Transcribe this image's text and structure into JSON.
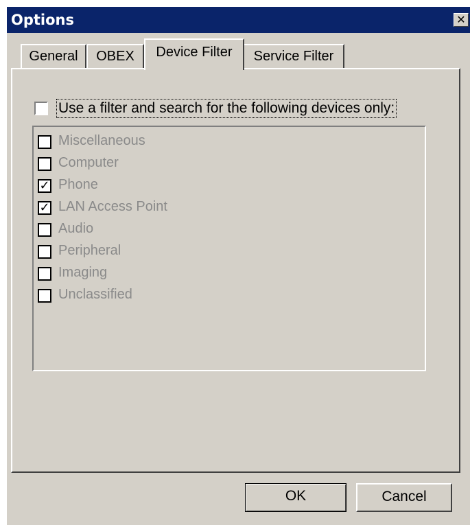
{
  "window": {
    "title": "Options",
    "close_glyph": "✕"
  },
  "tabs": [
    {
      "label": "General",
      "active": false
    },
    {
      "label": "OBEX",
      "active": false
    },
    {
      "label": "Device Filter",
      "active": true
    },
    {
      "label": "Service Filter",
      "active": false
    }
  ],
  "filter": {
    "label": "Use a filter and search for the following devices only:",
    "checked": false
  },
  "devices": [
    {
      "label": "Miscellaneous",
      "checked": false
    },
    {
      "label": "Computer",
      "checked": false
    },
    {
      "label": "Phone",
      "checked": true
    },
    {
      "label": "LAN Access Point",
      "checked": true
    },
    {
      "label": "Audio",
      "checked": false
    },
    {
      "label": "Peripheral",
      "checked": false
    },
    {
      "label": "Imaging",
      "checked": false
    },
    {
      "label": "Unclassified",
      "checked": false
    }
  ],
  "buttons": {
    "ok": "OK",
    "cancel": "Cancel"
  },
  "colors": {
    "titlebar": "#0a246a",
    "face": "#d4d0c8",
    "disabled_text": "#8a8a8a"
  },
  "check_glyph": "✓"
}
